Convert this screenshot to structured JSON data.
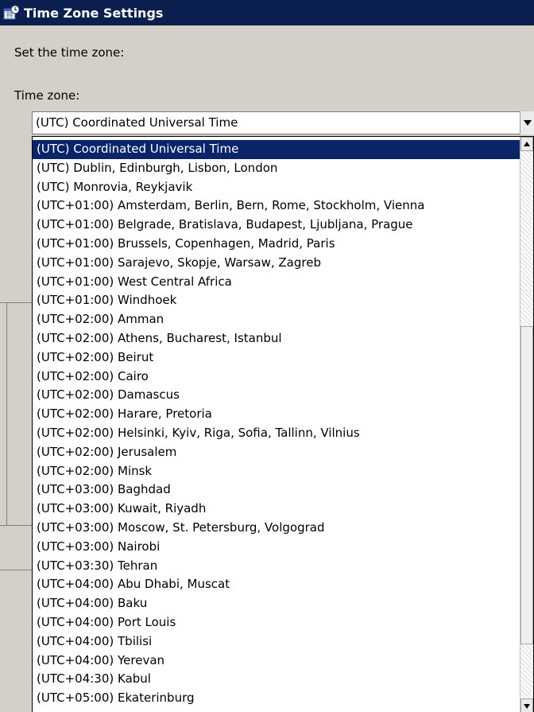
{
  "window": {
    "title": "Time Zone Settings"
  },
  "dialog": {
    "instruction": "Set the time zone:",
    "timezone_label": "Time zone:"
  },
  "combo": {
    "selected_value": "(UTC) Coordinated Universal Time"
  },
  "dropdown": {
    "selected_index": 0,
    "items": [
      "(UTC) Coordinated Universal Time",
      "(UTC) Dublin, Edinburgh, Lisbon, London",
      "(UTC) Monrovia, Reykjavik",
      "(UTC+01:00) Amsterdam, Berlin, Bern, Rome, Stockholm, Vienna",
      "(UTC+01:00) Belgrade, Bratislava, Budapest, Ljubljana, Prague",
      "(UTC+01:00) Brussels, Copenhagen, Madrid, Paris",
      "(UTC+01:00) Sarajevo, Skopje, Warsaw, Zagreb",
      "(UTC+01:00) West Central Africa",
      "(UTC+01:00) Windhoek",
      "(UTC+02:00) Amman",
      "(UTC+02:00) Athens, Bucharest, Istanbul",
      "(UTC+02:00) Beirut",
      "(UTC+02:00) Cairo",
      "(UTC+02:00) Damascus",
      "(UTC+02:00) Harare, Pretoria",
      "(UTC+02:00) Helsinki, Kyiv, Riga, Sofia, Tallinn, Vilnius",
      "(UTC+02:00) Jerusalem",
      "(UTC+02:00) Minsk",
      "(UTC+03:00) Baghdad",
      "(UTC+03:00) Kuwait, Riyadh",
      "(UTC+03:00) Moscow, St. Petersburg, Volgograd",
      "(UTC+03:00) Nairobi",
      "(UTC+03:30) Tehran",
      "(UTC+04:00) Abu Dhabi, Muscat",
      "(UTC+04:00) Baku",
      "(UTC+04:00) Port Louis",
      "(UTC+04:00) Tbilisi",
      "(UTC+04:00) Yerevan",
      "(UTC+04:30) Kabul",
      "(UTC+05:00) Ekaterinburg"
    ]
  },
  "icons": {
    "title": "calendar-clock-icon",
    "combo_button": "chevron-down-icon",
    "scroll_up": "scroll-up-arrow-icon",
    "scroll_down": "scroll-down-arrow-icon"
  },
  "colors": {
    "titlebar_bg": "#0b1f4f",
    "selection_bg": "#0a246a",
    "dialog_bg": "#d4d0c8"
  }
}
